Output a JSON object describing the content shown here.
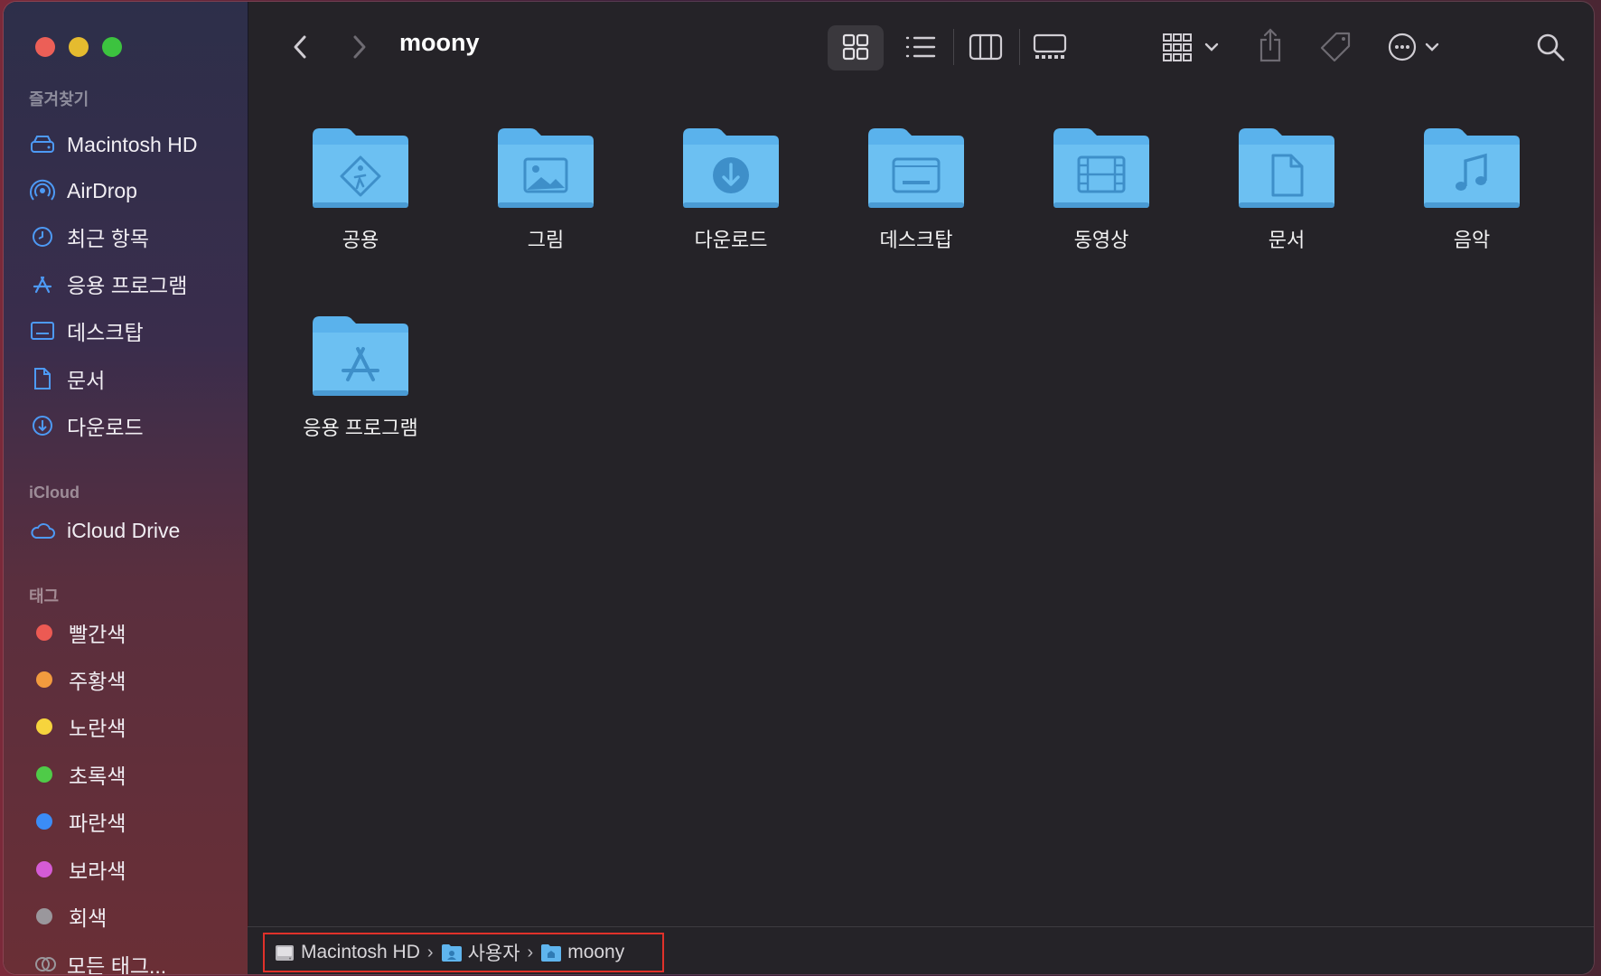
{
  "window": {
    "title": "moony"
  },
  "sidebar": {
    "favorites_title": "즐겨찾기",
    "favorites": [
      {
        "label": "Macintosh HD",
        "icon": "hard-drive-icon"
      },
      {
        "label": "AirDrop",
        "icon": "airdrop-icon"
      },
      {
        "label": "최근 항목",
        "icon": "clock-icon"
      },
      {
        "label": "응용 프로그램",
        "icon": "apps-icon"
      },
      {
        "label": "데스크탑",
        "icon": "desktop-icon"
      },
      {
        "label": "문서",
        "icon": "document-icon"
      },
      {
        "label": "다운로드",
        "icon": "download-icon"
      }
    ],
    "icloud_title": "iCloud",
    "icloud": [
      {
        "label": "iCloud Drive",
        "icon": "cloud-icon"
      }
    ],
    "tags_title": "태그",
    "tags": [
      {
        "label": "빨간색",
        "color": "#ec5a53"
      },
      {
        "label": "주황색",
        "color": "#f29b3e"
      },
      {
        "label": "노란색",
        "color": "#f6d43d"
      },
      {
        "label": "초록색",
        "color": "#4fcb48"
      },
      {
        "label": "파란색",
        "color": "#3b8cf6"
      },
      {
        "label": "보라색",
        "color": "#d55bd6"
      },
      {
        "label": "회색",
        "color": "#9a979c"
      },
      {
        "label": "모든 태그...",
        "color": ""
      }
    ]
  },
  "content": {
    "folders": [
      {
        "label": "공용",
        "icon": "public-folder-icon"
      },
      {
        "label": "그림",
        "icon": "pictures-folder-icon"
      },
      {
        "label": "다운로드",
        "icon": "downloads-folder-icon"
      },
      {
        "label": "데스크탑",
        "icon": "desktop-folder-icon"
      },
      {
        "label": "동영상",
        "icon": "movies-folder-icon"
      },
      {
        "label": "문서",
        "icon": "documents-folder-icon"
      },
      {
        "label": "음악",
        "icon": "music-folder-icon"
      },
      {
        "label": "응용 프로그램",
        "icon": "applications-folder-icon"
      }
    ]
  },
  "pathbar": {
    "crumbs": [
      {
        "label": "Macintosh HD",
        "icon": "hard-drive-icon"
      },
      {
        "label": "사용자",
        "icon": "users-folder-icon"
      },
      {
        "label": "moony",
        "icon": "home-folder-icon"
      }
    ],
    "separator": "›"
  },
  "colors": {
    "accent": "#3b8cf6",
    "folder": "#6cc0f2",
    "highlight": "#e0312a"
  }
}
